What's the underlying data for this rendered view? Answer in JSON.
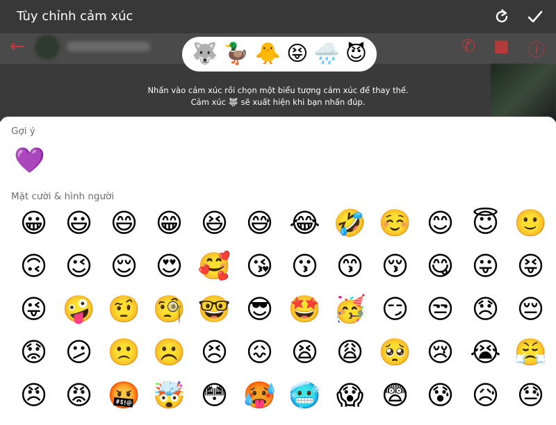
{
  "header": {
    "title": "Tùy chỉnh cảm xúc",
    "reset_icon": "refresh-icon",
    "confirm_icon": "checkmark-icon"
  },
  "pill": {
    "reactions": [
      "🐺",
      "🦆",
      "🐥",
      "😝",
      "🌧️",
      "😈"
    ]
  },
  "hint": {
    "line1": "Nhấn vào cảm xúc rồi chọn một biểu tượng cảm xúc để thay thế.",
    "line2": "Cảm xúc 🐺 sẽ xuất hiện khi bạn nhấn đúp."
  },
  "suggestions": {
    "label": "Gợi ý",
    "items": [
      "💜"
    ]
  },
  "smileys": {
    "label": "Mặt cười & hình người",
    "rows": [
      [
        "😀",
        "😃",
        "😄",
        "😁",
        "😆",
        "😅",
        "😂",
        "🤣",
        "☺️",
        "😊",
        "😇",
        "🙂"
      ],
      [
        "🙃",
        "😉",
        "😌",
        "😍",
        "🥰",
        "😘",
        "😗",
        "😙",
        "😚",
        "😋",
        "😛",
        "😝"
      ],
      [
        "😜",
        "🤪",
        "🤨",
        "🧐",
        "🤓",
        "😎",
        "🤩",
        "🥳",
        "😏",
        "😒",
        "😞",
        "😔"
      ],
      [
        "😟",
        "😕",
        "🙁",
        "☹️",
        "😣",
        "😖",
        "😫",
        "😩",
        "🥺",
        "😢",
        "😭",
        "😤"
      ],
      [
        "😠",
        "😡",
        "🤬",
        "🤯",
        "😳",
        "🥵",
        "🥶",
        "😱",
        "😨",
        "😰",
        "😥",
        "😓"
      ]
    ]
  },
  "colors": {
    "header_bg": "#383838",
    "accent_red": "#c43a3a",
    "section_text": "#6b6b6b"
  }
}
